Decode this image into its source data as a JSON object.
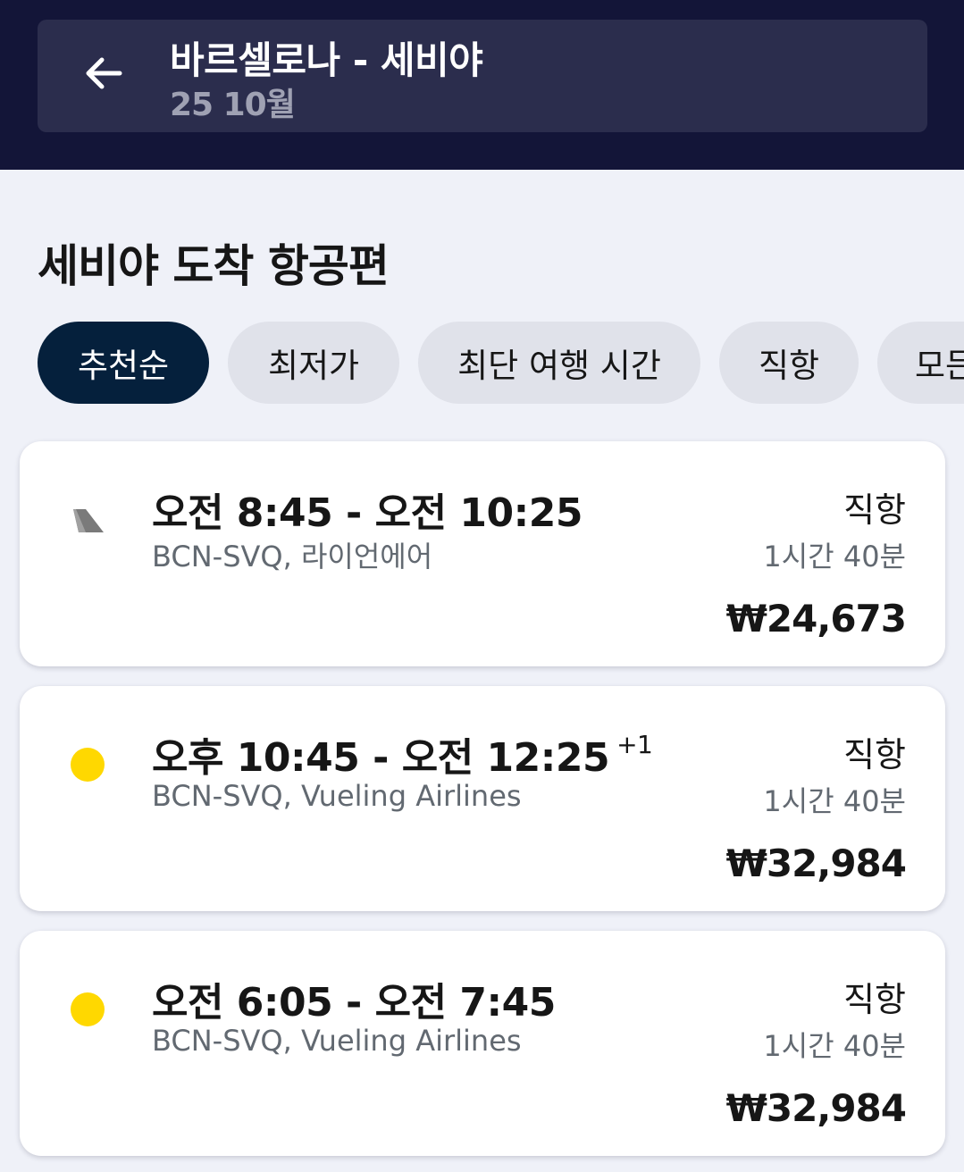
{
  "header": {
    "route_title": "바르셀로나 - 세비야",
    "date": "25 10월",
    "back_icon": "arrow-left-icon"
  },
  "section_title": "세비야 도착 항공편",
  "filters": [
    {
      "label": "추천순",
      "active": true
    },
    {
      "label": "최저가",
      "active": false
    },
    {
      "label": "최단 여행 시간",
      "active": false
    },
    {
      "label": "직항",
      "active": false
    },
    {
      "label": "모든",
      "active": false
    }
  ],
  "flights": [
    {
      "times": "오전 8:45 - 오전 10:25",
      "plus_day": "",
      "route_airline": "BCN-SVQ, 라이언에어",
      "stops": "직항",
      "duration": "1시간 40분",
      "price": "₩24,673",
      "logo": "ryanair-tail-logo-icon",
      "logo_color": "#7a7a7a"
    },
    {
      "times": "오후 10:45 - 오전 12:25",
      "plus_day": "+1",
      "route_airline": "BCN-SVQ, Vueling Airlines",
      "stops": "직항",
      "duration": "1시간 40분",
      "price": "₩32,984",
      "logo": "vueling-dot-logo-icon",
      "logo_color": "#ffd800"
    },
    {
      "times": "오전 6:05 - 오전 7:45",
      "plus_day": "",
      "route_airline": "BCN-SVQ, Vueling Airlines",
      "stops": "직항",
      "duration": "1시간 40분",
      "price": "₩32,984",
      "logo": "vueling-dot-logo-icon",
      "logo_color": "#ffd800"
    }
  ],
  "colors": {
    "topbar": "#131538",
    "search_box": "#2b2d4d",
    "active_chip": "#05203c",
    "chip": "#e0e2ea",
    "background": "#eff1f8"
  }
}
